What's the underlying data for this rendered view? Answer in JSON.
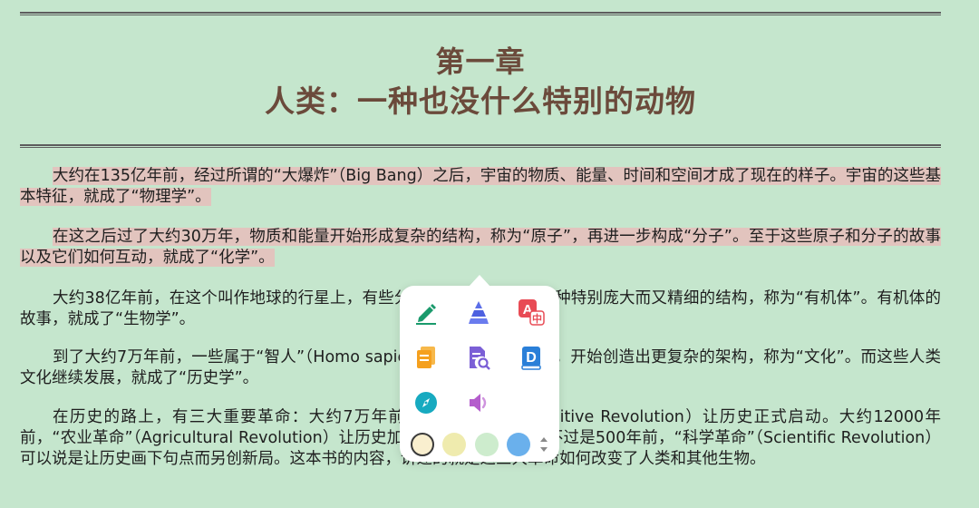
{
  "chapter": {
    "number": "第一章",
    "title": "人类：一种也没什么特别的动物"
  },
  "paragraphs": {
    "p1_hl": "大约在135亿年前，经过所谓的“大爆炸”（Big Bang）之后，宇宙的物质、能量、时间和空间才成了现在的样子。宇宙的这些基本特征，就成了“物理学”。",
    "p2_hl": "在这之后过了大约30万年，物质和能量开始形成复杂的结构，称为“原子”，再进一步构成“分子”。至于这些原子和分子的故事以及它们如何互动，就成了“化学”。",
    "p3": "大约38亿年前，在这个叫作地球的行星上，有些分子结合起来，形成一种特别庞大而又精细的结构，称为“有机体”。有机体的故事，就成了“生物学”。",
    "p4": "到了大约7万年前，一些属于“智人”（Homo sapiens）这一物种的生物，开始创造出更复杂的架构，称为“文化”。而这些人类文化继续发展，就成了“历史学”。",
    "p5": "在历史的路上，有三大重要革命：大约7万年前，“认知革命”（Cognitive Revolution）让历史正式启动。大约12000年前，“农业革命”（Agricultural Revolution）让历史加速发展。而到了大约不过是500年前，“科学革命”（Scientific Revolution）可以说是让历史画下句点而另创新局。这本书的内容，讲述的就是这三大革命如何改变了人类和其他生物。"
  },
  "popup": {
    "tools": [
      {
        "icon": "highlight-pen-icon",
        "color": "#1a9a6c"
      },
      {
        "icon": "stack-icon",
        "color": "#5b6ee8"
      },
      {
        "icon": "translate-icon",
        "color": "#e84b55"
      },
      {
        "icon": "copy-icon",
        "color": "#f5a01e"
      },
      {
        "icon": "search-document-icon",
        "color": "#7b5fd6"
      },
      {
        "icon": "dictionary-icon",
        "color": "#2a7fd8"
      },
      {
        "icon": "compass-icon",
        "color": "#17aac0"
      },
      {
        "icon": "speaker-icon",
        "color": "#b45dcc"
      }
    ],
    "colors": [
      "#f9efcf",
      "#efebae",
      "#cdeccd",
      "#6ab0ec"
    ],
    "selected_color_index": 0
  }
}
